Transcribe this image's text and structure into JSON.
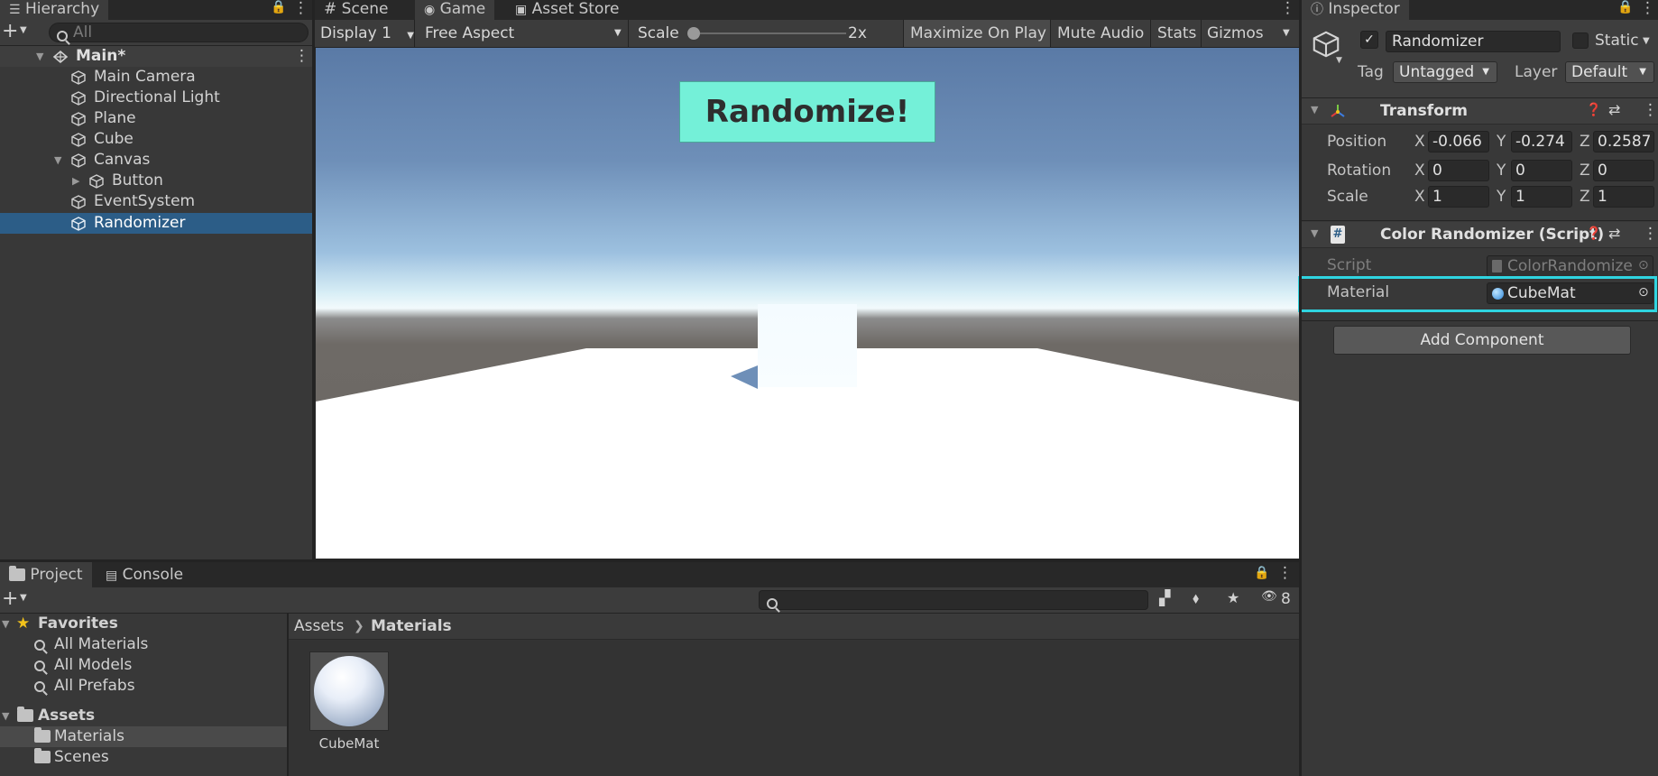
{
  "hierarchy": {
    "tab_label": "Hierarchy",
    "search_placeholder": "All",
    "scene_name": "Main*",
    "items": [
      {
        "label": "Main Camera"
      },
      {
        "label": "Directional Light"
      },
      {
        "label": "Plane"
      },
      {
        "label": "Cube"
      },
      {
        "label": "Canvas"
      },
      {
        "label": "Button"
      },
      {
        "label": "EventSystem"
      },
      {
        "label": "Randomizer"
      }
    ]
  },
  "center_tabs": {
    "scene": "Scene",
    "game": "Game",
    "asset_store": "Asset Store"
  },
  "game_toolbar": {
    "display": "Display 1",
    "aspect": "Free Aspect",
    "scale_label": "Scale",
    "scale_value": "2x",
    "maximize": "Maximize On Play",
    "mute": "Mute Audio",
    "stats": "Stats",
    "gizmos": "Gizmos"
  },
  "game_view": {
    "button_label": "Randomize!",
    "button_color": "#74f0d8"
  },
  "inspector": {
    "tab_label": "Inspector",
    "object_name": "Randomizer",
    "static_label": "Static",
    "tag_label": "Tag",
    "tag_value": "Untagged",
    "layer_label": "Layer",
    "layer_value": "Default",
    "transform": {
      "title": "Transform",
      "rows": [
        {
          "label": "Position",
          "x": "-0.066",
          "y": "-0.274",
          "z": "0.2587"
        },
        {
          "label": "Rotation",
          "x": "0",
          "y": "0",
          "z": "0"
        },
        {
          "label": "Scale",
          "x": "1",
          "y": "1",
          "z": "1"
        }
      ],
      "axis_x": "X",
      "axis_y": "Y",
      "axis_z": "Z"
    },
    "script_component": {
      "title": "Color Randomizer (Script)",
      "script_label": "Script",
      "script_value": "ColorRandomize",
      "material_label": "Material",
      "material_value": "CubeMat",
      "highlight_color": "#2fd4e0"
    },
    "add_component": "Add Component"
  },
  "bottom_tabs": {
    "project": "Project",
    "console": "Console"
  },
  "project": {
    "favorites_label": "Favorites",
    "favorites": [
      "All Materials",
      "All Models",
      "All Prefabs"
    ],
    "assets_label": "Assets",
    "asset_folders": [
      "Materials",
      "Scenes"
    ],
    "breadcrumb_root": "Assets",
    "breadcrumb_current": "Materials",
    "hidden_count": "8",
    "asset_items": [
      {
        "label": "CubeMat"
      }
    ]
  },
  "colors": {
    "selection": "#2c5d87",
    "star": "#f2c21b"
  }
}
